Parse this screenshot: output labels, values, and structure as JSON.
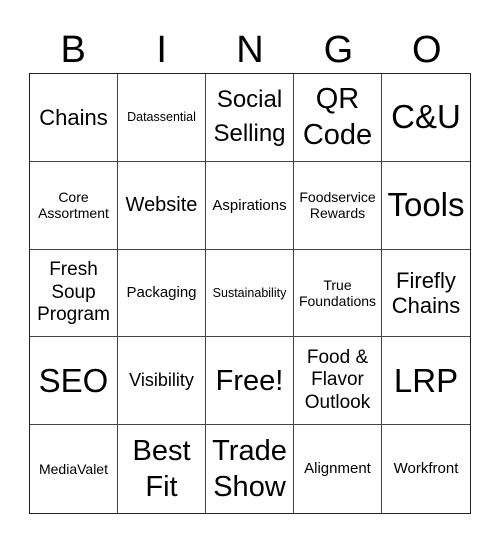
{
  "header": [
    "B",
    "I",
    "N",
    "G",
    "O"
  ],
  "cells": [
    "Chains",
    "Datassential",
    "Social Selling",
    "QR Code",
    "C&U",
    "Core Assortment",
    "Website",
    "Aspirations",
    "Foodservice Rewards",
    "Tools",
    "Fresh Soup Program",
    "Packaging",
    "Sustainability",
    "True Foundations",
    "Firefly Chains",
    "SEO",
    "Visibility",
    "Free!",
    "Food & Flavor Outlook",
    "LRP",
    "MediaValet",
    "Best Fit",
    "Trade Show",
    "Alignment",
    "Workfront"
  ],
  "free_space_index": 17
}
